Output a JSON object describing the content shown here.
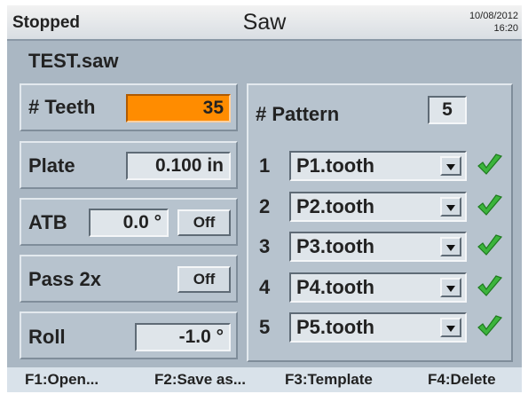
{
  "header": {
    "status": "Stopped",
    "title": "Saw",
    "date": "10/08/2012",
    "time": "16:20"
  },
  "filename": "TEST.saw",
  "teeth": {
    "label": "# Teeth",
    "value": "35"
  },
  "plate": {
    "label": "Plate",
    "value": "0.100 in"
  },
  "atb": {
    "label": "ATB",
    "value": "0.0 °",
    "toggle": "Off"
  },
  "pass2x": {
    "label": "Pass 2x",
    "toggle": "Off"
  },
  "roll": {
    "label": "Roll",
    "value": "-1.0 °"
  },
  "pattern": {
    "label": "# Pattern",
    "count": "5",
    "rows": [
      {
        "num": "1",
        "file": "P1.tooth"
      },
      {
        "num": "2",
        "file": "P2.tooth"
      },
      {
        "num": "3",
        "file": "P3.tooth"
      },
      {
        "num": "4",
        "file": "P4.tooth"
      },
      {
        "num": "5",
        "file": "P5.tooth"
      }
    ]
  },
  "function_keys": [
    "F1:Open...",
    "F2:Save as...",
    "F3:Template",
    "F4:Delete"
  ],
  "colors": {
    "accent": "#ff8c00",
    "check": "#3cb43c",
    "background": "#aab7c3"
  },
  "icons": {
    "dropdown": "chevron-down-icon",
    "check": "check-icon"
  }
}
